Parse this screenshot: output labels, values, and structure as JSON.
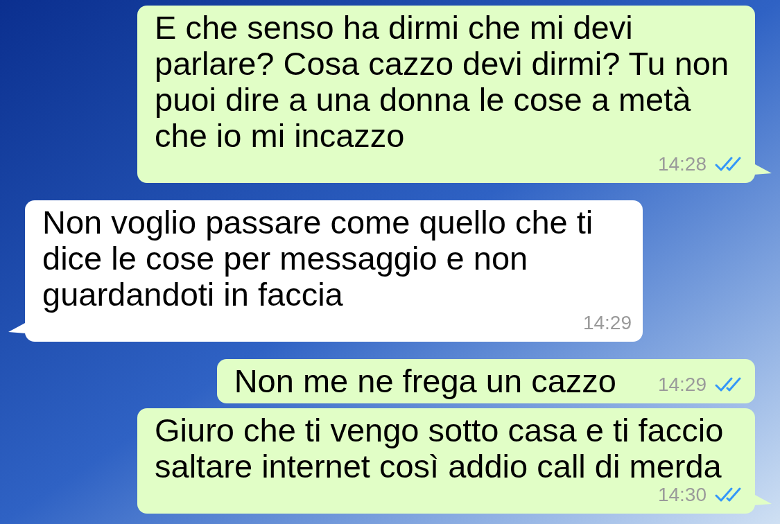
{
  "messages": [
    {
      "sent": true,
      "text": "E che senso ha dirmi che mi devi parlare? Cosa cazzo devi dirmi? Tu non puoi dire a una donna le cose a metà che io mi incazzo",
      "time": "14:28",
      "read": true
    },
    {
      "sent": false,
      "text": "Non voglio passare come quello che ti dice le cose per messaggio e non guardandoti in faccia",
      "time": "14:29"
    },
    {
      "sent": true,
      "text": "Non me ne frega un cazzo",
      "time": "14:29",
      "read": true
    },
    {
      "sent": true,
      "text": "Giuro che ti vengo sotto casa e ti faccio saltare internet così addio call di merda",
      "time": "14:30",
      "read": true
    }
  ]
}
